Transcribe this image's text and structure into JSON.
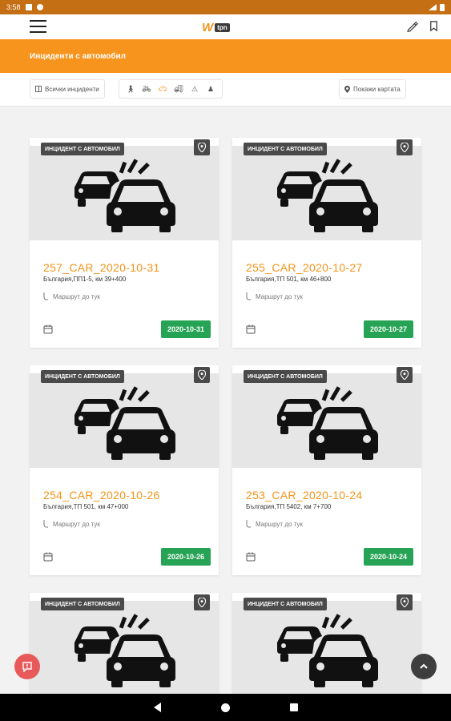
{
  "status_bar": {
    "time": "3:58"
  },
  "app": {
    "logo_text": "W",
    "logo_badge": "tpn"
  },
  "header": {
    "title": "Инциденти с автомобил"
  },
  "filters": {
    "all_label": "Всички инциденти",
    "map_label": "Покажи картата",
    "types": [
      "pedestrian-icon",
      "bicycle-icon",
      "car-crash-icon",
      "truck-icon",
      "warning-icon",
      "person-icon"
    ],
    "active_type": "car-crash-icon"
  },
  "cards": [
    {
      "badge": "ИНЦИДЕНТ С АВТОМОБИЛ",
      "title": "257_CAR_2020-10-31",
      "location": "България,ПП1-5, км 39+400",
      "route": "Маршрут до тук",
      "date": "2020-10-31"
    },
    {
      "badge": "ИНЦИДЕНТ С АВТОМОБИЛ",
      "title": "255_CAR_2020-10-27",
      "location": "България,ТП 501, км 46+800",
      "route": "Маршрут до тук",
      "date": "2020-10-27"
    },
    {
      "badge": "ИНЦИДЕНТ С АВТОМОБИЛ",
      "title": "254_CAR_2020-10-26",
      "location": "България,ТП 501, км 47+000",
      "route": "Маршрут до тук",
      "date": "2020-10-26"
    },
    {
      "badge": "ИНЦИДЕНТ С АВТОМОБИЛ",
      "title": "253_CAR_2020-10-24",
      "location": "България,ТП 5402, км 7+700",
      "route": "Маршрут до тук",
      "date": "2020-10-24"
    },
    {
      "badge": "ИНЦИДЕНТ С АВТОМОБИЛ",
      "title": "",
      "location": "",
      "route": "",
      "date": ""
    },
    {
      "badge": "ИНЦИДЕНТ С АВТОМОБИЛ",
      "title": "",
      "location": "",
      "route": "",
      "date": ""
    }
  ],
  "colors": {
    "accent": "#f7941d",
    "date_badge": "#27a355",
    "status_bar": "#c46f13",
    "badge": "#4a4a4a"
  }
}
